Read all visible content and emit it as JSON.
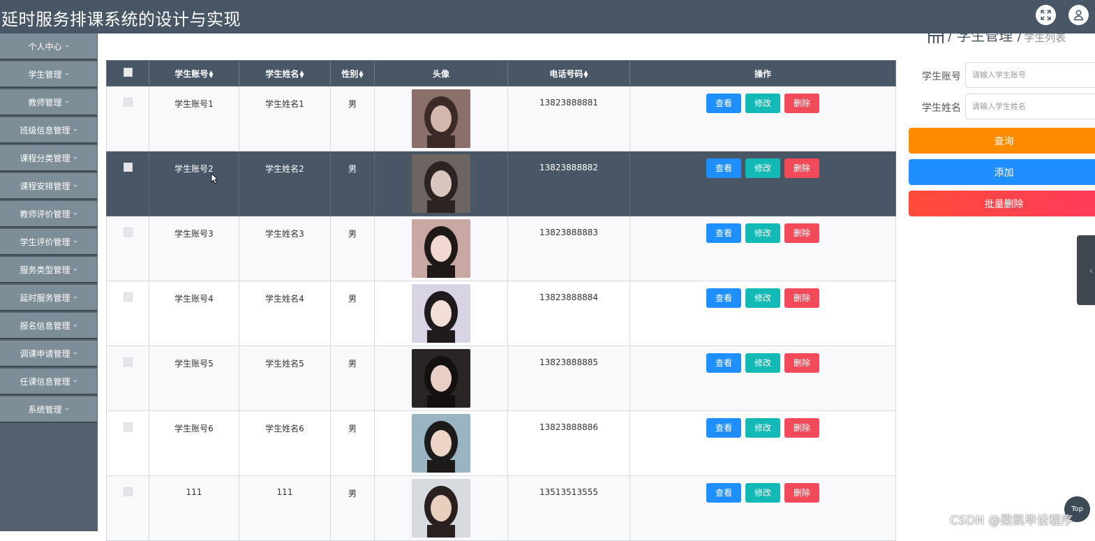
{
  "header": {
    "title": "延时服务排课系统的设计与实现",
    "fullscreen_icon": "fullscreen-icon",
    "user_icon": "user-icon"
  },
  "sidebar": {
    "items": [
      {
        "label": "个人中心"
      },
      {
        "label": "学生管理"
      },
      {
        "label": "教师管理"
      },
      {
        "label": "班级信息管理"
      },
      {
        "label": "课程分类管理"
      },
      {
        "label": "课程安排管理"
      },
      {
        "label": "教师评价管理"
      },
      {
        "label": "学生评价管理"
      },
      {
        "label": "服务类型管理"
      },
      {
        "label": "延时服务管理"
      },
      {
        "label": "报名信息管理"
      },
      {
        "label": "调课申请管理"
      },
      {
        "label": "任课信息管理"
      },
      {
        "label": "系统管理"
      }
    ]
  },
  "breadcrumb": {
    "section": "/ 学生管理 /",
    "page": "学生列表"
  },
  "search": {
    "account_label": "学生账号",
    "account_placeholder": "请输入学生账号",
    "name_label": "学生姓名",
    "name_placeholder": "请输入学生姓名",
    "query_label": "查询",
    "add_label": "添加",
    "batch_delete_label": "批量删除"
  },
  "table": {
    "headers": {
      "account": "学生账号",
      "name": "学生姓名",
      "gender": "性别",
      "avatar": "头像",
      "phone": "电话号码",
      "actions": "操作"
    },
    "rows": [
      {
        "account": "学生账号1",
        "name": "学生姓名1",
        "gender": "男",
        "phone": "13823888881",
        "view": "查看",
        "edit": "修改",
        "delete": "删除"
      },
      {
        "account": "学生账号2",
        "name": "学生姓名2",
        "gender": "男",
        "phone": "13823888882",
        "view": "查看",
        "edit": "修改",
        "delete": "删除"
      },
      {
        "account": "学生账号3",
        "name": "学生姓名3",
        "gender": "男",
        "phone": "13823888883",
        "view": "查看",
        "edit": "修改",
        "delete": "删除"
      },
      {
        "account": "学生账号4",
        "name": "学生姓名4",
        "gender": "男",
        "phone": "13823888884",
        "view": "查看",
        "edit": "修改",
        "delete": "删除"
      },
      {
        "account": "学生账号5",
        "name": "学生姓名5",
        "gender": "男",
        "phone": "13823888885",
        "view": "查看",
        "edit": "修改",
        "delete": "删除"
      },
      {
        "account": "学生账号6",
        "name": "学生姓名6",
        "gender": "男",
        "phone": "13823888886",
        "view": "查看",
        "edit": "修改",
        "delete": "删除"
      },
      {
        "account": "111",
        "name": "111",
        "gender": "男",
        "phone": "13513513555",
        "view": "查看",
        "edit": "修改",
        "delete": "删除"
      }
    ]
  },
  "back_to_top": "Top",
  "watermark": "CSDN @梁凯毕设程序",
  "colors": {
    "topbar": "#495666",
    "sidebar_item": "#7e8e98",
    "view": "#1f8fff",
    "edit": "#13b9b5",
    "delete": "#f34a5a",
    "query": "#ff8c00"
  }
}
